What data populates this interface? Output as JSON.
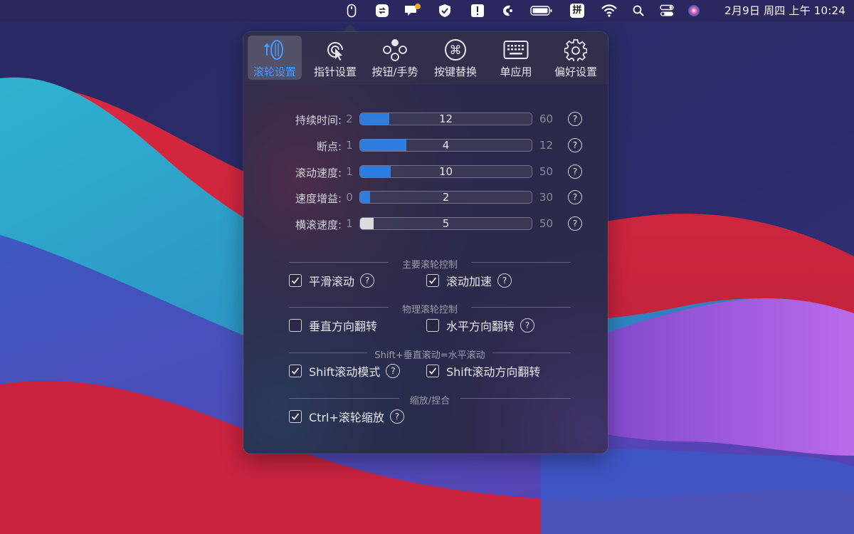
{
  "menubar": {
    "clock": "2月9日 周四 上午 10:24",
    "icons": [
      "mouse-icon",
      "sync-icon",
      "message-icon",
      "shield-check-icon",
      "alert-icon",
      "app-icon",
      "battery-icon",
      "input-method-icon",
      "wifi-icon",
      "search-icon",
      "control-center-icon",
      "siri-icon"
    ],
    "input_method_label": "拼"
  },
  "toolbar": {
    "tabs": [
      {
        "label": "滚轮设置",
        "icon": "scroll-wheel-icon",
        "active": true
      },
      {
        "label": "指针设置",
        "icon": "pointer-icon",
        "active": false
      },
      {
        "label": "按钮/手势",
        "icon": "buttons-gesture-icon",
        "active": false
      },
      {
        "label": "按键替换",
        "icon": "command-key-icon",
        "active": false
      },
      {
        "label": "单应用",
        "icon": "keyboard-icon",
        "active": false
      },
      {
        "label": "偏好设置",
        "icon": "gear-icon",
        "active": false
      }
    ]
  },
  "sliders": [
    {
      "label": "持续时间:",
      "min": "2",
      "max": "60",
      "value": "12",
      "fraction": 0.17,
      "style": "blue"
    },
    {
      "label": "断点:",
      "min": "1",
      "max": "12",
      "value": "4",
      "fraction": 0.27,
      "style": "blue"
    },
    {
      "label": "滚动速度:",
      "min": "1",
      "max": "50",
      "value": "10",
      "fraction": 0.18,
      "style": "blue"
    },
    {
      "label": "速度增益:",
      "min": "0",
      "max": "30",
      "value": "2",
      "fraction": 0.06,
      "style": "blue"
    },
    {
      "label": "横滚速度:",
      "min": "1",
      "max": "50",
      "value": "5",
      "fraction": 0.08,
      "style": "white"
    }
  ],
  "help_glyph": "?",
  "sections": [
    {
      "title": "主要滚轮控制",
      "options": [
        {
          "label": "平滑滚动",
          "checked": true,
          "help": true
        },
        {
          "label": "滚动加速",
          "checked": true,
          "help": true
        }
      ]
    },
    {
      "title": "物理滚轮控制",
      "options": [
        {
          "label": "垂直方向翻转",
          "checked": false,
          "help": false
        },
        {
          "label": "水平方向翻转",
          "checked": false,
          "help": true
        }
      ]
    },
    {
      "title": "Shift+垂直滚动=水平滚动",
      "options": [
        {
          "label": "Shift滚动模式",
          "checked": true,
          "help": true
        },
        {
          "label": "Shift滚动方向翻转",
          "checked": true,
          "help": false
        }
      ]
    },
    {
      "title": "缩放/捏合",
      "options": [
        {
          "label": "Ctrl+滚轮缩放",
          "checked": true,
          "help": true
        }
      ]
    }
  ],
  "colors": {
    "accent": "#2f7ddf",
    "active_tab_label": "#4a9bff",
    "badge": "#f5a623"
  }
}
